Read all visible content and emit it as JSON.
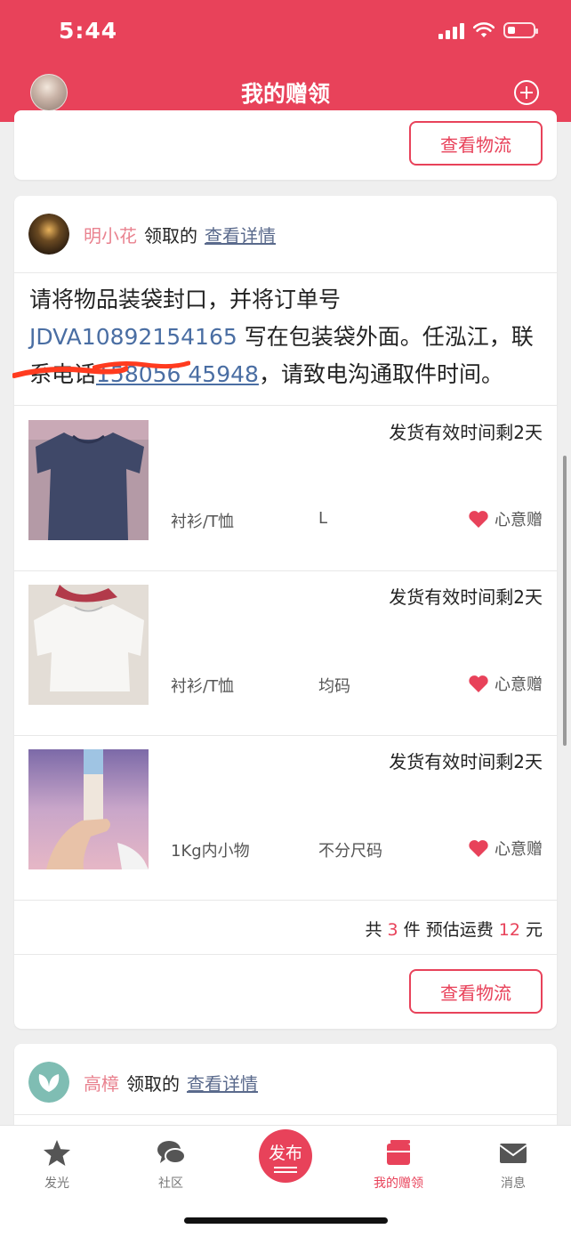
{
  "status_bar": {
    "time": "5:44"
  },
  "header": {
    "title": "我的赠领"
  },
  "buttons": {
    "view_logistics": "查看物流"
  },
  "claims": [
    {
      "user_name": "明小花",
      "claimed_text": "领取的",
      "detail_link": "查看详情",
      "message": {
        "part1": "请将物品装袋封口，并将订单号",
        "order_no": "JDVA10892154165",
        "part2": "写在包装袋外面。任泓江，联系电话",
        "phone": "158056 45948",
        "part3": "，请致电沟通取件时间。"
      },
      "items": [
        {
          "deadline": "发货有效时间剩2天",
          "category": "衬衫/T恤",
          "size": "L",
          "tag": "心意赠"
        },
        {
          "deadline": "发货有效时间剩2天",
          "category": "衬衫/T恤",
          "size": "均码",
          "tag": "心意赠"
        },
        {
          "deadline": "发货有效时间剩2天",
          "category": "1Kg内小物",
          "size": "不分尺码",
          "tag": "心意赠"
        }
      ],
      "summary": {
        "prefix": "共",
        "count": "3",
        "mid": "件 预估运费",
        "fee": "12",
        "suffix": "元"
      }
    },
    {
      "user_name": "高樟",
      "claimed_text": "领取的",
      "detail_link": "查看详情"
    }
  ],
  "tabbar": {
    "tabs": [
      {
        "label": "发光",
        "icon": "star-icon"
      },
      {
        "label": "社区",
        "icon": "chat-bubbles-icon"
      },
      {
        "label": "发布",
        "icon": "publish-button"
      },
      {
        "label": "我的赠领",
        "icon": "gift-box-icon"
      },
      {
        "label": "消息",
        "icon": "envelope-icon"
      }
    ],
    "active_index": 3
  },
  "colors": {
    "brand": "#e8425a",
    "link": "#4a6ea3",
    "username": "#e9828f"
  }
}
